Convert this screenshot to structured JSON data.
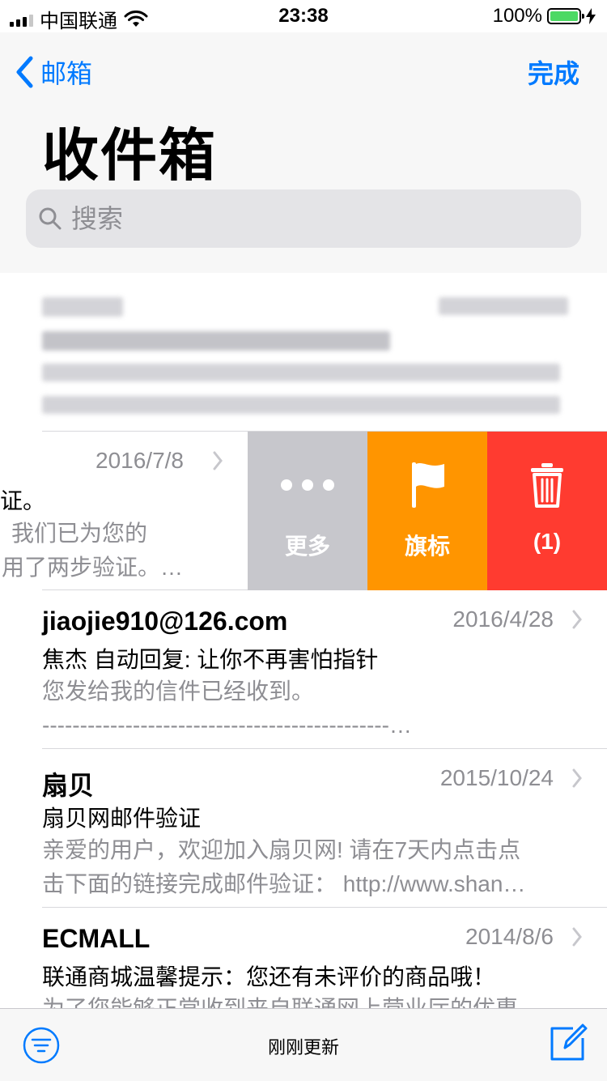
{
  "status_bar": {
    "carrier": "中国联通",
    "time": "23:38",
    "battery": "100%"
  },
  "nav": {
    "back_label": "邮箱",
    "done_label": "完成",
    "title": "收件箱"
  },
  "search": {
    "placeholder": "搜索"
  },
  "swiped_message": {
    "date": "2016/7/8",
    "line1": "证。",
    "line2": "我们已为您的",
    "line3": "用了两步验证。…",
    "actions": [
      {
        "label": "更多",
        "icon": "ellipsis-icon",
        "color": "#c7c7cc"
      },
      {
        "label": "旗标",
        "icon": "flag-icon",
        "color": "#ff9500"
      },
      {
        "label": "(1)",
        "icon": "trash-icon",
        "color": "#ff3b30"
      }
    ]
  },
  "messages": [
    {
      "sender": "jiaojie910@126.com",
      "date": "2016/4/28",
      "subject": "焦杰 自动回复: 让你不再害怕指针",
      "preview": "您发给我的信件已经收到。\n----------------------------------------------…"
    },
    {
      "sender": "扇贝",
      "date": "2015/10/24",
      "subject": "扇贝网邮件验证",
      "preview": "亲爱的用户，欢迎加入扇贝网! 请在7天内点击点\n击下面的链接完成邮件验证：  http://www.shan…"
    },
    {
      "sender": "ECMALL",
      "date": "2014/8/6",
      "subject": "联通商城温馨提示：您还有未评价的商品哦！",
      "preview": "为了您能够正常收到来自联通网上营业厅的优惠"
    }
  ],
  "toolbar": {
    "status": "刚刚更新"
  },
  "colors": {
    "accent": "#007aff",
    "more": "#c7c7cc",
    "flag": "#ff9500",
    "delete": "#ff3b30",
    "battery": "#4cd964"
  }
}
